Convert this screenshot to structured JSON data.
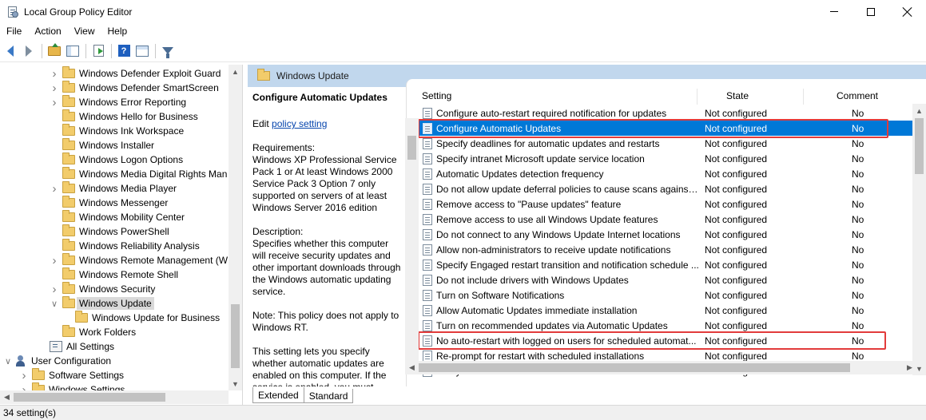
{
  "window": {
    "title": "Local Group Policy Editor"
  },
  "menu": [
    "File",
    "Action",
    "View",
    "Help"
  ],
  "toolbar": {
    "icons": [
      "arrow-left-icon",
      "arrow-right-icon",
      "folder-up-icon",
      "tree-view-icon",
      "export-icon",
      "help-icon",
      "view-icon",
      "filter-icon"
    ]
  },
  "tree": {
    "items": [
      {
        "label": "Windows Defender Exploit Guard",
        "expandable": true
      },
      {
        "label": "Windows Defender SmartScreen",
        "expandable": true
      },
      {
        "label": "Windows Error Reporting",
        "expandable": true
      },
      {
        "label": "Windows Hello for Business",
        "expandable": false
      },
      {
        "label": "Windows Ink Workspace",
        "expandable": false
      },
      {
        "label": "Windows Installer",
        "expandable": false
      },
      {
        "label": "Windows Logon Options",
        "expandable": false
      },
      {
        "label": "Windows Media Digital Rights Man",
        "expandable": false
      },
      {
        "label": "Windows Media Player",
        "expandable": true
      },
      {
        "label": "Windows Messenger",
        "expandable": false
      },
      {
        "label": "Windows Mobility Center",
        "expandable": false
      },
      {
        "label": "Windows PowerShell",
        "expandable": false
      },
      {
        "label": "Windows Reliability Analysis",
        "expandable": false
      },
      {
        "label": "Windows Remote Management (W",
        "expandable": true
      },
      {
        "label": "Windows Remote Shell",
        "expandable": false
      },
      {
        "label": "Windows Security",
        "expandable": true
      },
      {
        "label": "Windows Update",
        "expandable": true,
        "expanded": true,
        "selected": true
      },
      {
        "label": "Windows Update for Business",
        "child": true
      },
      {
        "label": "Work Folders",
        "expandable": false
      }
    ],
    "all_settings": "All Settings",
    "user_configuration": "User Configuration",
    "software_settings": "Software Settings",
    "windows_settings": "Windows Settings"
  },
  "right_header": {
    "title": "Windows Update"
  },
  "description": {
    "title": "Configure Automatic Updates",
    "edit_prefix": "Edit ",
    "edit_link": "policy setting",
    "requirements": "Requirements:\nWindows XP Professional Service Pack 1 or At least Windows 2000 Service Pack 3 Option 7 only supported on servers of at least Windows Server 2016 edition",
    "description": "Description:\nSpecifies whether this computer will receive security updates and other important downloads through the Windows automatic updating service.",
    "note": "Note: This policy does not apply to Windows RT.",
    "setting_text": "This setting lets you specify whether automatic updates are enabled on this computer. If the service is enabled, you must select"
  },
  "columns": {
    "setting": "Setting",
    "state": "State",
    "comment": "Comment"
  },
  "policies": [
    {
      "name": "Configure auto-restart required notification for updates",
      "state": "Not configured",
      "comment": "No"
    },
    {
      "name": "Configure Automatic Updates",
      "state": "Not configured",
      "comment": "No",
      "selected": true
    },
    {
      "name": "Specify deadlines for automatic updates and restarts",
      "state": "Not configured",
      "comment": "No"
    },
    {
      "name": "Specify intranet Microsoft update service location",
      "state": "Not configured",
      "comment": "No"
    },
    {
      "name": "Automatic Updates detection frequency",
      "state": "Not configured",
      "comment": "No"
    },
    {
      "name": "Do not allow update deferral policies to cause scans against ...",
      "state": "Not configured",
      "comment": "No"
    },
    {
      "name": "Remove access to \"Pause updates\" feature",
      "state": "Not configured",
      "comment": "No"
    },
    {
      "name": "Remove access to use all Windows Update features",
      "state": "Not configured",
      "comment": "No"
    },
    {
      "name": "Do not connect to any Windows Update Internet locations",
      "state": "Not configured",
      "comment": "No"
    },
    {
      "name": "Allow non-administrators to receive update notifications",
      "state": "Not configured",
      "comment": "No"
    },
    {
      "name": "Specify Engaged restart transition and notification schedule ...",
      "state": "Not configured",
      "comment": "No"
    },
    {
      "name": "Do not include drivers with Windows Updates",
      "state": "Not configured",
      "comment": "No"
    },
    {
      "name": "Turn on Software Notifications",
      "state": "Not configured",
      "comment": "No"
    },
    {
      "name": "Allow Automatic Updates immediate installation",
      "state": "Not configured",
      "comment": "No"
    },
    {
      "name": "Turn on recommended updates via Automatic Updates",
      "state": "Not configured",
      "comment": "No"
    },
    {
      "name": "No auto-restart with logged on users for scheduled automat...",
      "state": "Not configured",
      "comment": "No"
    },
    {
      "name": "Re-prompt for restart with scheduled installations",
      "state": "Not configured",
      "comment": "No"
    },
    {
      "name": "Delay Restart for scheduled installations",
      "state": "Not configured",
      "comment": "No"
    }
  ],
  "highlight_color": "#e23b3b",
  "selection_color": "#0078d7",
  "tabs": [
    "Extended",
    "Standard"
  ],
  "status": {
    "text": "34 setting(s)"
  }
}
